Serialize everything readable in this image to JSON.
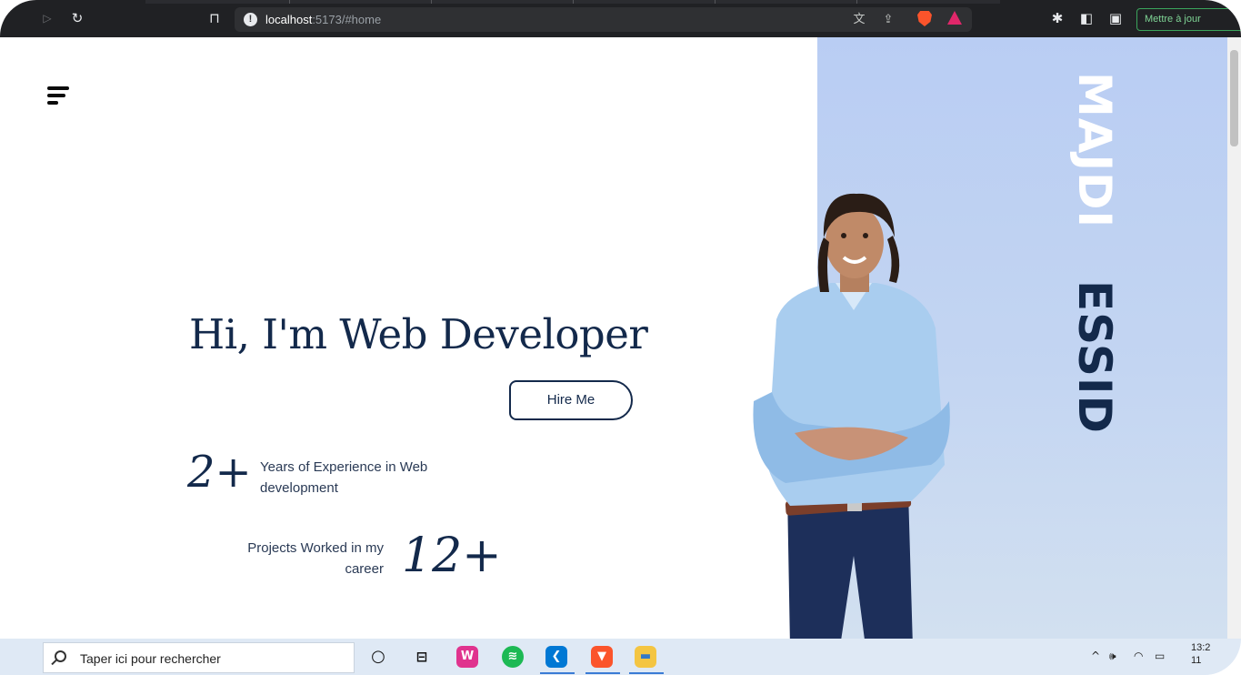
{
  "browser": {
    "url_host": "localhost",
    "url_path": ":5173/#home",
    "update_button": "Mettre à jour"
  },
  "page": {
    "name_first": "MAJDI",
    "name_last": "ESSID",
    "hero_title": "Hi, I'm Web Developer",
    "hire_button": "Hire Me",
    "stats": [
      {
        "number": "2+",
        "line1": "Years of Experience in Web",
        "line2": "development"
      },
      {
        "number": "12+",
        "line1": "Projects Worked in my",
        "line2": "career"
      }
    ],
    "colors": {
      "navy": "#13294b",
      "panel": "#b9cdf3"
    }
  },
  "taskbar": {
    "search_placeholder": "Taper ici pour rechercher",
    "apps": [
      "cortana-icon",
      "task-view-icon",
      "wamp-icon",
      "spotify-icon",
      "vscode-icon",
      "brave-icon",
      "file-explorer-icon"
    ],
    "clock_time": "13:2",
    "clock_date": "11"
  }
}
